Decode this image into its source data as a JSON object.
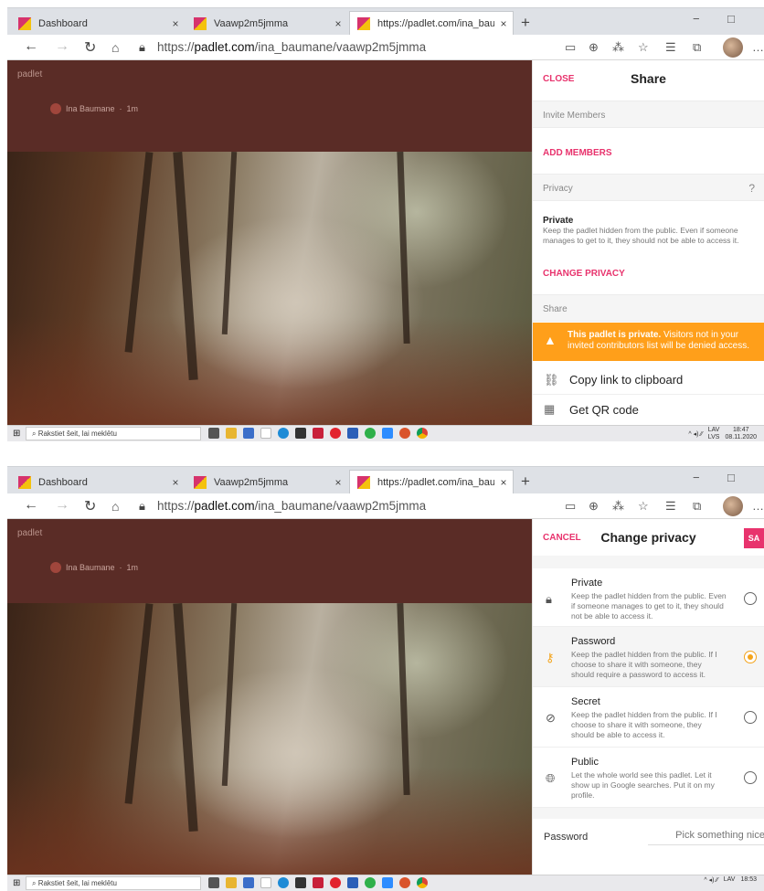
{
  "browser": {
    "tabs": [
      {
        "label": "Dashboard",
        "close": "×"
      },
      {
        "label": "Vaawp2m5jmma",
        "close": "×"
      },
      {
        "label": "https://padlet.com/ina_baumane",
        "close": "×"
      }
    ],
    "new_tab": "+",
    "url_scheme": "https://",
    "url_host": "padlet.com",
    "url_path": "/ina_baumane/vaawp2m5jmma",
    "window_minimize": "−",
    "window_maximize": "□"
  },
  "page": {
    "logo": "padlet",
    "author": "Ina Baumane",
    "age": "1m"
  },
  "share_panel": {
    "close": "CLOSE",
    "title": "Share",
    "invite_heading": "Invite Members",
    "add_members": "ADD MEMBERS",
    "privacy_heading": "Privacy",
    "privacy_value": "Private",
    "privacy_desc": "Keep the padlet hidden from the public. Even if someone manages to get to it, they should not be able to access it.",
    "change_privacy": "CHANGE PRIVACY",
    "share_heading": "Share",
    "warning_bold": "This padlet is private.",
    "warning_text": "Visitors not in your invited contributors list will be denied access.",
    "copy_link": "Copy link to clipboard",
    "qr_code": "Get QR code"
  },
  "privacy_panel": {
    "cancel": "CANCEL",
    "title": "Change privacy",
    "save": "SA",
    "options": [
      {
        "name": "Private",
        "desc": "Keep the padlet hidden from the public. Even if someone manages to get to it, they should not be able to access it.",
        "selected": false
      },
      {
        "name": "Password",
        "desc": "Keep the padlet hidden from the public. If I choose to share it with someone, they should require a password to access it.",
        "selected": true
      },
      {
        "name": "Secret",
        "desc": "Keep the padlet hidden from the public. If I choose to share it with someone, they should be able to access it.",
        "selected": false
      },
      {
        "name": "Public",
        "desc": "Let the whole world see this padlet. Let it show up in Google searches. Put it on my profile.",
        "selected": false
      }
    ],
    "password_label": "Password",
    "password_placeholder": "Pick something nice"
  },
  "taskbar": {
    "search_placeholder": "Rakstiet šeit, lai meklētu",
    "lang_top": "LAV",
    "lang_bottom": "LVS",
    "time_1": "18:47",
    "date_1": "08.11.2020",
    "time_2": "18:53"
  },
  "colors": {
    "accent": "#e8336d",
    "warning": "#ff9f1a",
    "header_bg": "#5a2c26"
  }
}
